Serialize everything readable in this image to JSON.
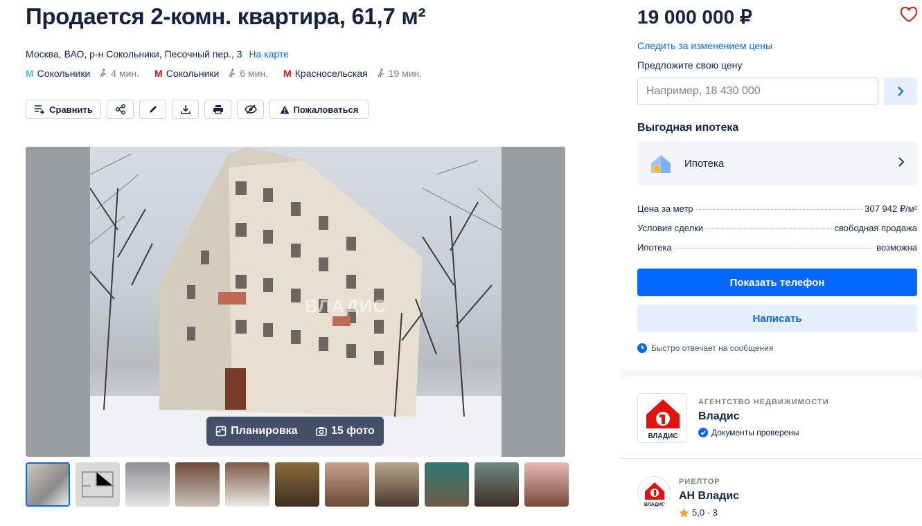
{
  "title": "Продается 2-комн. квартира, 61,7 м²",
  "address": {
    "text": "Москва, ВАО, р-н Сокольники, Песочный пер., 3",
    "map_link": "На карте"
  },
  "metro": [
    {
      "station": "Сокольники",
      "time": "4 мин.",
      "color": "#4fc3c9"
    },
    {
      "station": "Сокольники",
      "time": "6 мин.",
      "color": "#e4120f"
    },
    {
      "station": "Красносельская",
      "time": "19 мин.",
      "color": "#e4120f"
    }
  ],
  "toolbar": {
    "compare": "Сравнить",
    "share_icon": "share-icon",
    "edit_icon": "edit-icon",
    "download_icon": "download-icon",
    "print_icon": "print-icon",
    "hide_icon": "hide-icon",
    "complain": "Пожаловаться"
  },
  "gallery": {
    "watermark": "ВЛАДИС",
    "layout_label": "Планировка",
    "photos_label": "15 фото"
  },
  "sidebar": {
    "price": "19 000 000 ₽",
    "follow": "Следить за изменением цены",
    "offer_label": "Предложите свою цену",
    "offer_placeholder": "Например, 18 430 000",
    "mortgage_heading": "Выгодная ипотека",
    "mortgage_item": "Ипотека",
    "rows": [
      {
        "label": "Цена за метр",
        "value": "307 942 ₽/м²"
      },
      {
        "label": "Условия сделки",
        "value": "свободная продажа"
      },
      {
        "label": "Ипотека",
        "value": "возможна"
      }
    ],
    "show_phone": "Показать телефон",
    "write": "Написать",
    "fast_reply": "Быстро отвечает на сообщения"
  },
  "agency": {
    "type": "АГЕНТСТВО НЕДВИЖИМОСТИ",
    "name": "Владис",
    "verified": "Документы проверены",
    "logo_text": "ВЛАДИС"
  },
  "realtor": {
    "type": "РИЕЛТОР",
    "name": "АН Владис",
    "rating": "5,0 · 3",
    "logo_text": "ВЛАДИС"
  },
  "colors": {
    "accent": "#0468ff",
    "text": "#152242",
    "brand_red": "#e4120f"
  }
}
